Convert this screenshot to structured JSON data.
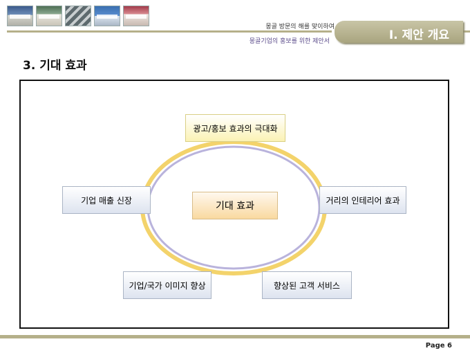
{
  "header": {
    "thumbnails": [
      {
        "name": "storefront-photo-1"
      },
      {
        "name": "storefront-photo-2"
      },
      {
        "name": "storefront-photo-3"
      },
      {
        "name": "storefront-photo-4"
      },
      {
        "name": "storefront-photo-5"
      }
    ],
    "subtitle_line1": "몽골 방문의 해를 맞이하여",
    "subtitle_line2": "몽골기업의 홍보를 위한 제안서",
    "section_title": "I. 제안 개요"
  },
  "heading": "3. 기대 효과",
  "diagram": {
    "center": "기대 효과",
    "nodes": {
      "top": "광고/홍보 효과의 극대화",
      "left": "기업 매출 신장",
      "right": "거리의 인테리어 효과",
      "bottom_left": "기업/국가 이미지 향상",
      "bottom_right": "향상된 고객 서비스"
    },
    "colors": {
      "ring_outer": "#f3d36b",
      "ring_inner": "#b9b3dc"
    }
  },
  "footer": {
    "page": "Page 6"
  }
}
